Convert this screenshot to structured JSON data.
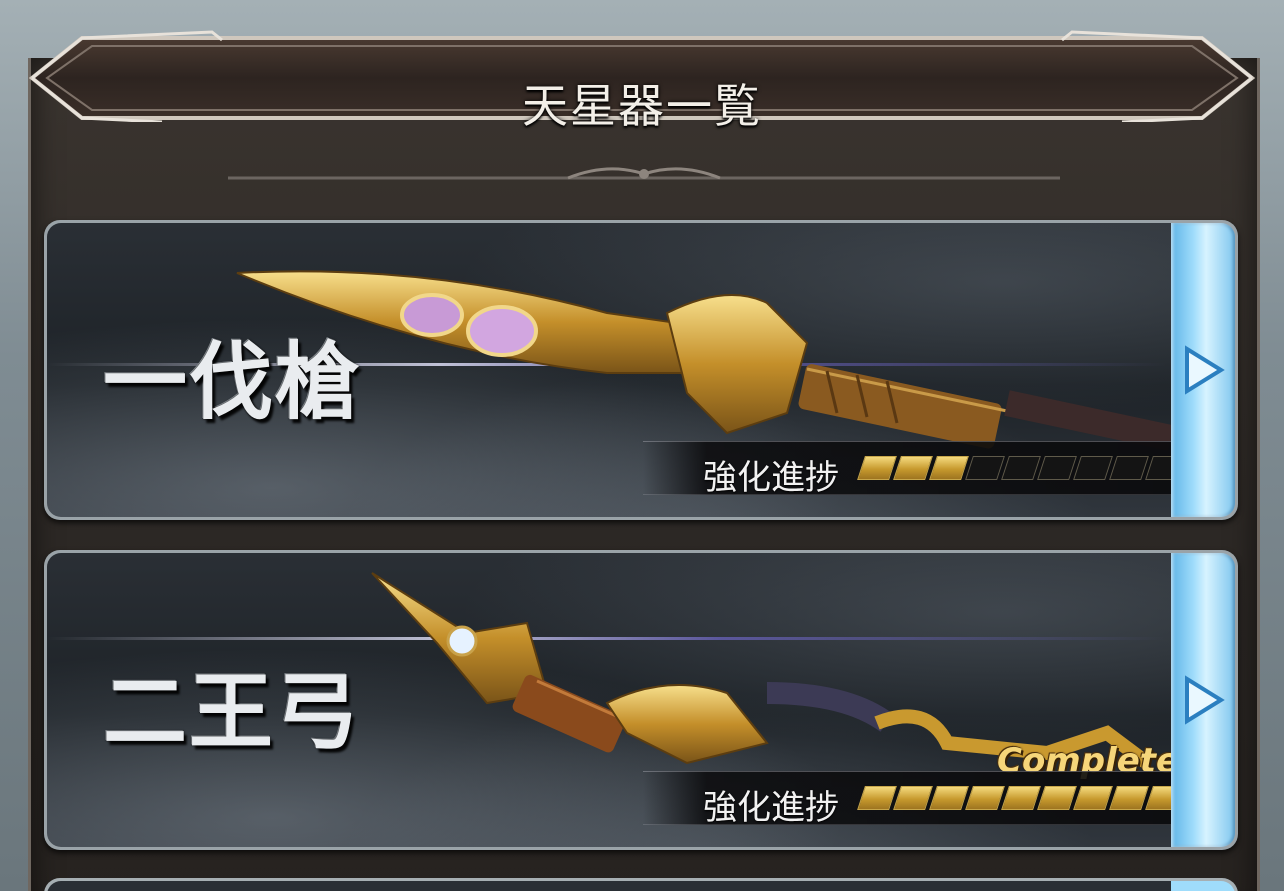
{
  "header": {
    "title": "天星器一覧"
  },
  "cards": [
    {
      "name": "一伐槍",
      "progress_label": "強化進捗",
      "progress_filled": 3,
      "progress_total": 9,
      "complete_text": ""
    },
    {
      "name": "二王弓",
      "progress_label": "強化進捗",
      "progress_filled": 9,
      "progress_total": 9,
      "complete_text": "Complete!"
    }
  ],
  "colors": {
    "gold": "#d6a93c",
    "accent_blue": "#9fdcfb",
    "frame": "#2b2724"
  },
  "icons": {
    "next_arrow": "play-arrow-icon"
  }
}
